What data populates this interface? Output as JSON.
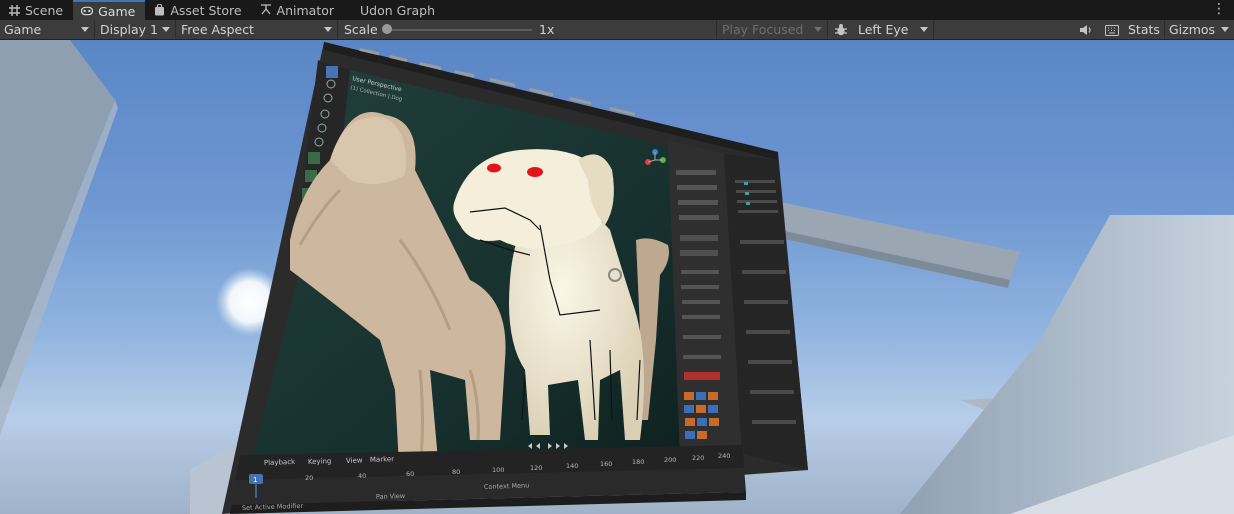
{
  "tabs": [
    {
      "label": "Scene",
      "icon": "grid-icon",
      "active": false
    },
    {
      "label": "Game",
      "icon": "gamepad-icon",
      "active": true
    },
    {
      "label": "Asset Store",
      "icon": "bag-icon",
      "active": false
    },
    {
      "label": "Animator",
      "icon": "animator-icon",
      "active": false
    },
    {
      "label": "Udon Graph",
      "icon": "",
      "active": false
    }
  ],
  "toolbar": {
    "mode": "Game",
    "display": "Display 1",
    "aspect": "Free Aspect",
    "scale_label": "Scale",
    "scale_value": "1x",
    "play_focused": "Play Focused",
    "eye": "Left Eye",
    "stats": "Stats",
    "gizmos": "Gizmos"
  },
  "blender": {
    "header_title": "User Perspective",
    "header_sub": "(1) Collection | Dog",
    "timeline_menu": [
      "Playback",
      "Keying",
      "View",
      "Marker"
    ],
    "frame_current": "1",
    "frame_ticks": [
      "20",
      "40",
      "60",
      "80",
      "100",
      "120",
      "140",
      "160",
      "180",
      "200",
      "220",
      "240"
    ],
    "status": [
      "Set Active Modifier",
      "Pan View",
      "Context Menu"
    ]
  },
  "colors": {
    "tab_accent": "#3a79bb",
    "toolbar_bg": "#3c3c3c",
    "sky_top": "#5a86c6",
    "sky_bottom": "#b8cde8",
    "dog_body": "#f1e9d2",
    "dog_eyes": "#e0141a",
    "furry_dog": "#cdb79e",
    "viewport_bg": "#1f3a36"
  }
}
